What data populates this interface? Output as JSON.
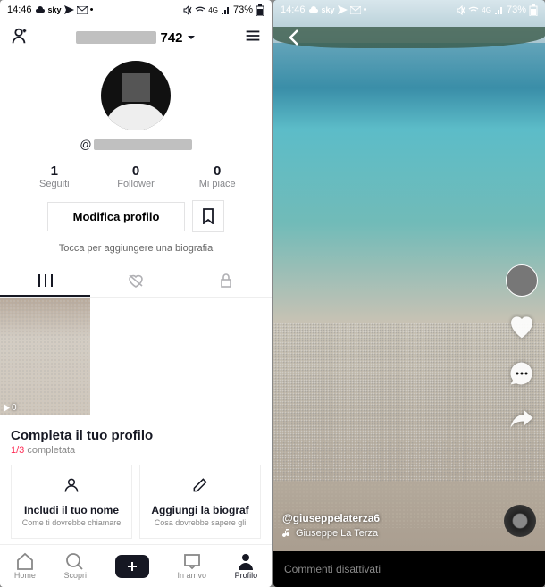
{
  "status": {
    "time": "14:46",
    "battery": "73%"
  },
  "profile": {
    "title_visible_part": "742",
    "username_prefix": "@",
    "stats": {
      "following_num": "1",
      "following_lbl": "Seguiti",
      "followers_num": "0",
      "followers_lbl": "Follower",
      "likes_num": "0",
      "likes_lbl": "Mi piace"
    },
    "edit_btn": "Modifica profilo",
    "bio_hint": "Tocca per aggiungere una biografia",
    "grid_views": "0"
  },
  "complete": {
    "title": "Completa il tuo profilo",
    "progress_done": "1/3",
    "progress_rest": " completata",
    "card1_title": "Includi il tuo nome",
    "card1_sub": "Come ti dovrebbe chiamare",
    "card2_title": "Aggiungi la biograf",
    "card2_sub": "Cosa dovrebbe sapere gli"
  },
  "nav": {
    "home": "Home",
    "discover": "Scopri",
    "inbox": "In arrivo",
    "profile": "Profilo"
  },
  "feed": {
    "author": "@giuseppelaterza6",
    "sound": "Giuseppe La Terza",
    "comments_off": "Commenti disattivati"
  }
}
